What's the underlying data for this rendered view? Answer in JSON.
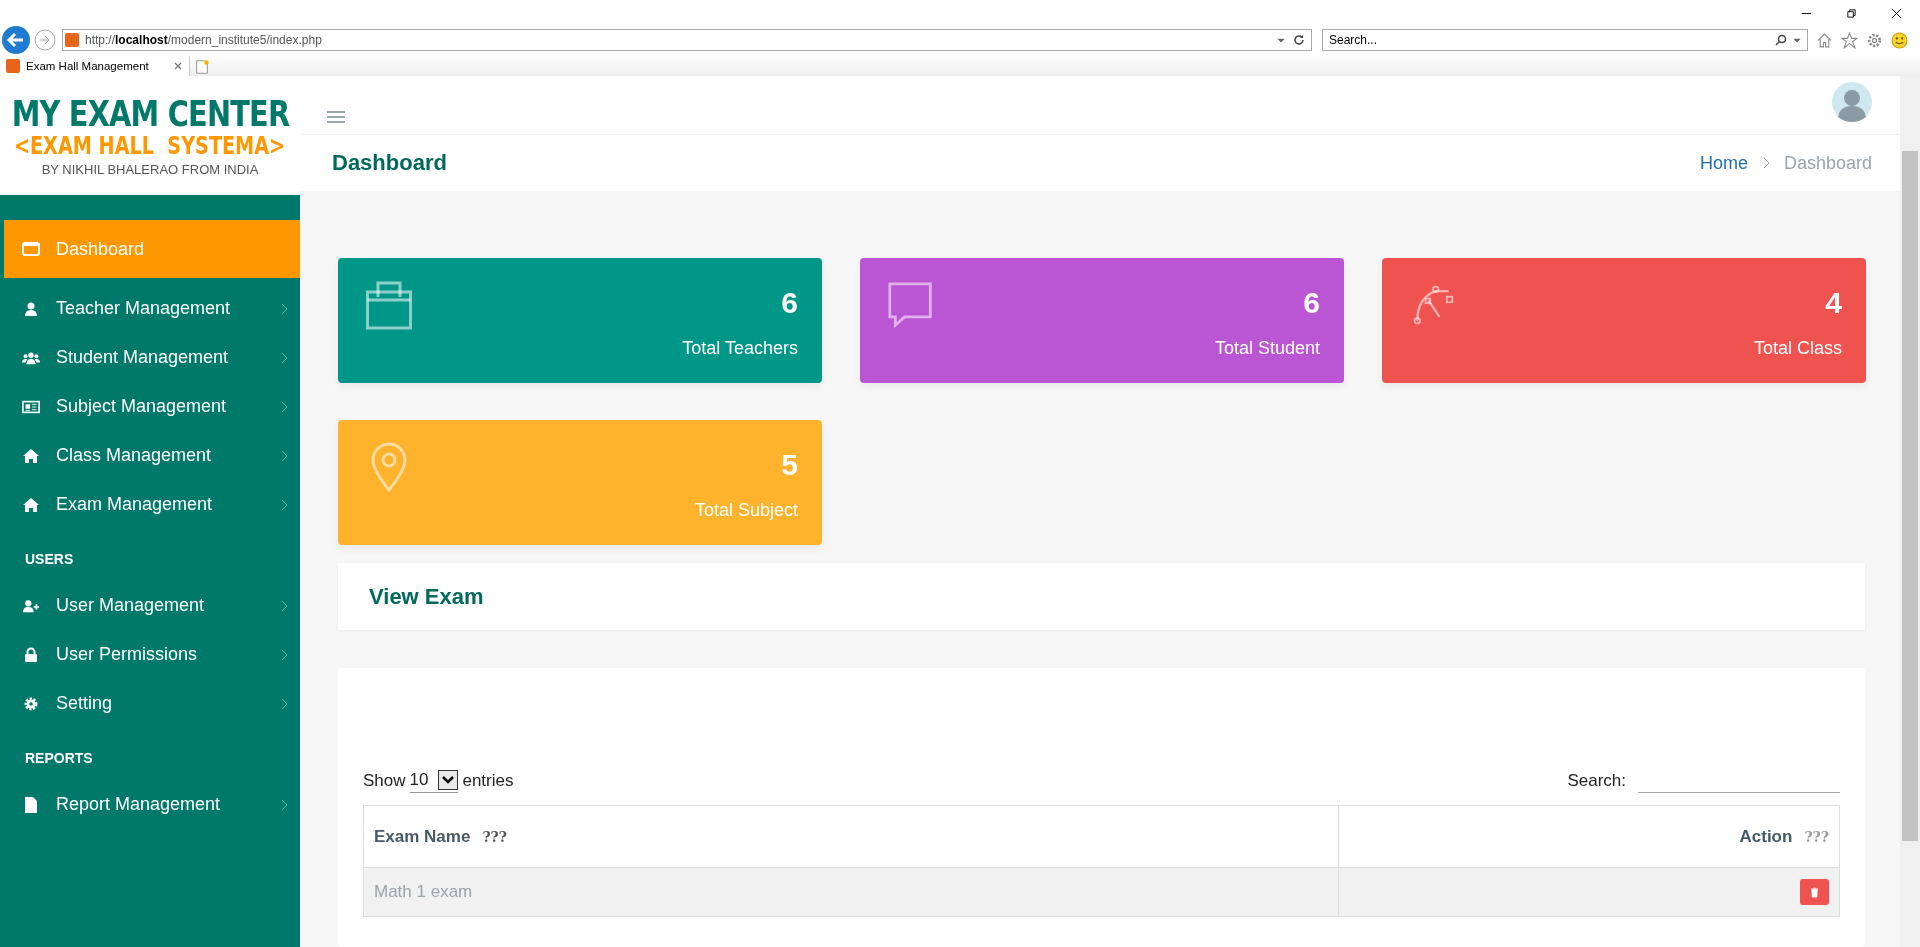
{
  "browser": {
    "address": "http://**localhost**/modern_institute5/index.php",
    "search": {
      "placeholder": "Search..."
    },
    "tabs": [
      {
        "label": "Exam Hall Management",
        "selected": true
      }
    ]
  },
  "sidebar": {
    "logo": {
      "title": "MY EXAM CENTER",
      "subtitle": "<EXAM HALL  SYSTEMA>",
      "byline": "BY NIKHIL BHALERAO FROM INDIA"
    },
    "sections": [
      {
        "items": [
          {
            "label": "Dashboard",
            "selected": true,
            "expandable": false
          },
          {
            "label": "Teacher Management",
            "selected": false,
            "expandable": true
          },
          {
            "label": "Student Management",
            "selected": false,
            "expandable": true
          },
          {
            "label": "Subject Management",
            "selected": false,
            "expandable": true
          },
          {
            "label": "Class Management",
            "selected": false,
            "expandable": true
          },
          {
            "label": "Exam Management",
            "selected": false,
            "expandable": true
          }
        ]
      },
      {
        "heading": "USERS",
        "items": [
          {
            "label": "User Management",
            "selected": false,
            "expandable": true
          },
          {
            "label": "User Permissions",
            "selected": false,
            "expandable": true
          },
          {
            "label": "Setting",
            "selected": false,
            "expandable": true
          }
        ]
      },
      {
        "heading": "REPORTS",
        "items": [
          {
            "label": "Report Management",
            "selected": false,
            "expandable": true
          }
        ]
      }
    ]
  },
  "header": {
    "title": "Dashboard",
    "breadcrumb": [
      "Home",
      "Dashboard"
    ]
  },
  "cards": [
    {
      "value": "6",
      "label": "Total Teachers",
      "color": "#009688"
    },
    {
      "value": "6",
      "label": "Total Student",
      "color": "#ba55d3"
    },
    {
      "value": "4",
      "label": "Total Class",
      "color": "#ef5350"
    },
    {
      "value": "5",
      "label": "Total Subject",
      "color": "#ffb22b"
    }
  ],
  "panel": {
    "title": "View Exam"
  },
  "table": {
    "show_label": "Show",
    "length": "10",
    "entries_label": "entries",
    "search_label": "Search:",
    "columns": [
      {
        "label": "Exam Name",
        "sort": "???"
      },
      {
        "label": "Action",
        "sort": "???"
      }
    ],
    "rows": [
      {
        "exam_name": "Math 1 exam"
      }
    ]
  }
}
